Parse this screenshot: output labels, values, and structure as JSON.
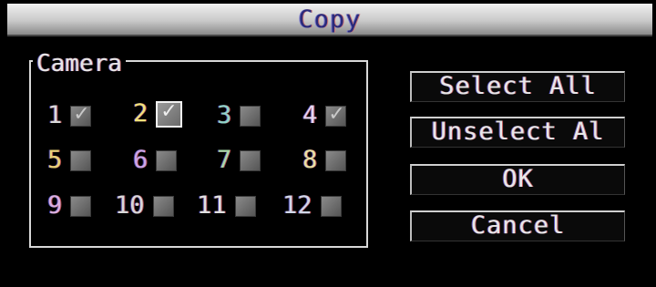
{
  "dialog": {
    "title": "Copy",
    "group_label": "Camera"
  },
  "cameras": [
    {
      "label": "1",
      "checked": true,
      "color": "#d9d9d9"
    },
    {
      "label": "2",
      "checked": true,
      "color": "#f0e27a"
    },
    {
      "label": "3",
      "checked": false,
      "color": "#8fd4c8"
    },
    {
      "label": "4",
      "checked": true,
      "color": "#e4d6f0"
    },
    {
      "label": "5",
      "checked": false,
      "color": "#e8d276"
    },
    {
      "label": "6",
      "checked": false,
      "color": "#c8a6e8"
    },
    {
      "label": "7",
      "checked": false,
      "color": "#a8d8a8"
    },
    {
      "label": "8",
      "checked": false,
      "color": "#e8e0a0"
    },
    {
      "label": "9",
      "checked": false,
      "color": "#d8b0e0"
    },
    {
      "label": "10",
      "checked": false,
      "color": "#d8d8d8"
    },
    {
      "label": "11",
      "checked": false,
      "color": "#e0e0e0"
    },
    {
      "label": "12",
      "checked": false,
      "color": "#d0d8e8"
    }
  ],
  "buttons": {
    "select_all": "Select All",
    "unselect_all": "Unselect Al",
    "ok": "OK",
    "cancel": "Cancel"
  }
}
